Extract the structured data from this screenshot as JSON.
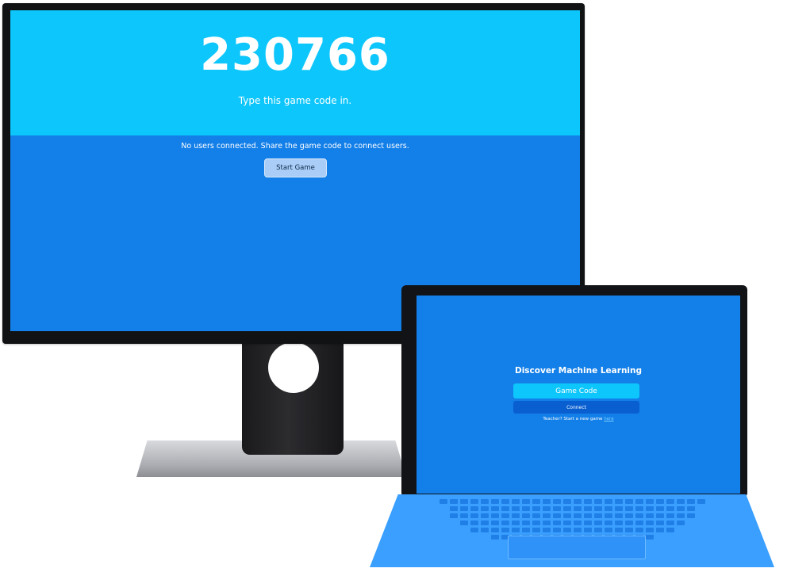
{
  "monitor": {
    "game_code": "230766",
    "hint": "Type this game code in.",
    "status": "No users connected. Share the game code to connect users.",
    "start_button": "Start Game"
  },
  "tablet": {
    "title": "Discover Machine Learning",
    "code_placeholder": "Game Code",
    "connect_button": "Connect",
    "teacher_prompt": "Teacher? Start a new game",
    "teacher_link": "here"
  },
  "colors": {
    "hero_cyan": "#0dc6fc",
    "screen_blue": "#137fe8",
    "keyboard_blue": "#3a9fff"
  }
}
